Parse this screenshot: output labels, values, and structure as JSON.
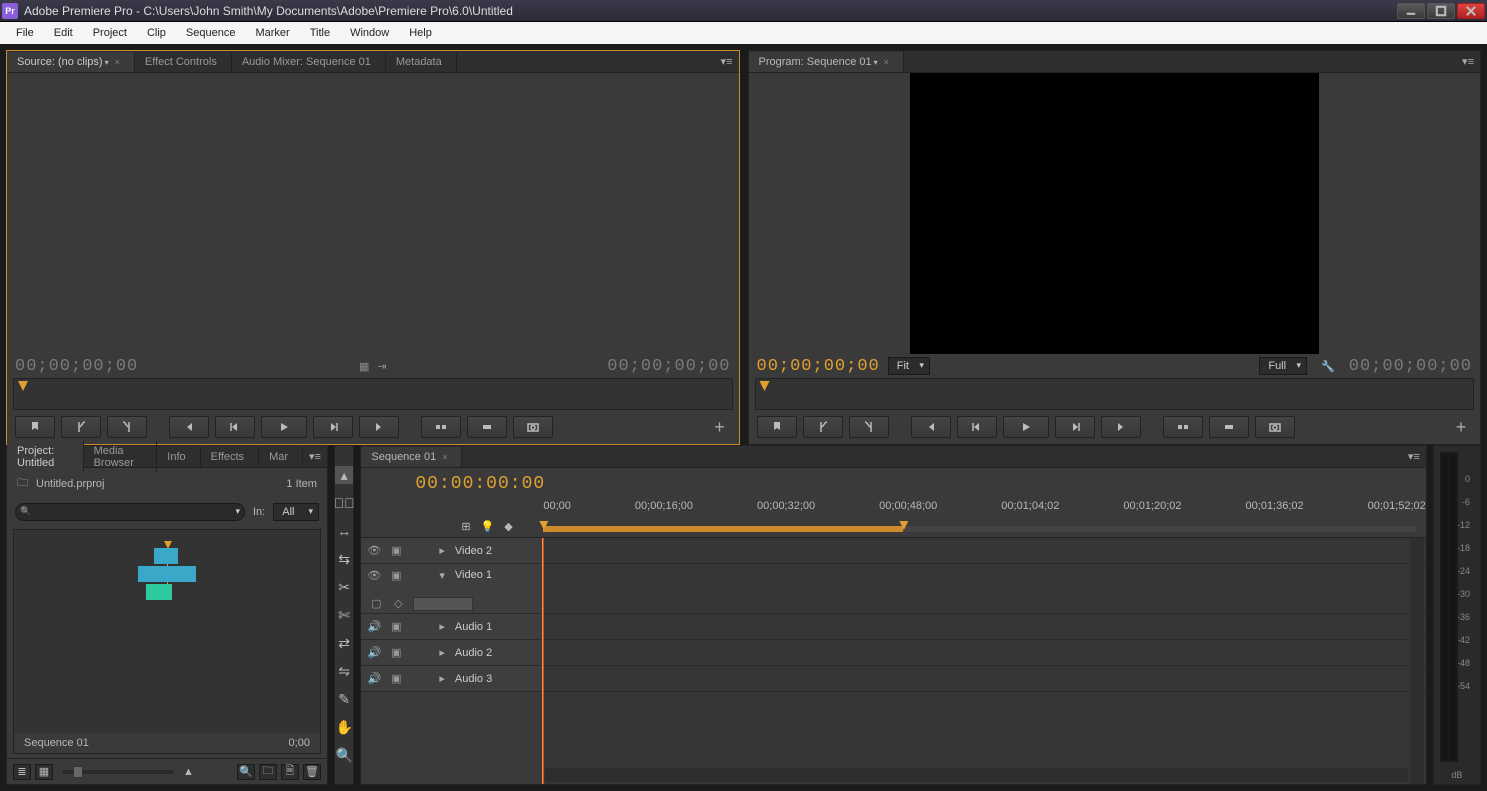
{
  "title": "Adobe Premiere Pro - C:\\Users\\John Smith\\My Documents\\Adobe\\Premiere Pro\\6.0\\Untitled",
  "menu": [
    "File",
    "Edit",
    "Project",
    "Clip",
    "Sequence",
    "Marker",
    "Title",
    "Window",
    "Help"
  ],
  "source": {
    "tabs": [
      "Source: (no clips)",
      "Effect Controls",
      "Audio Mixer: Sequence 01",
      "Metadata"
    ],
    "active_tab": 0,
    "tc_left": "00;00;00;00",
    "tc_right": "00;00;00;00"
  },
  "program": {
    "tab": "Program: Sequence 01",
    "tc_left": "00;00;00;00",
    "tc_right": "00;00;00;00",
    "zoom": "Fit",
    "quality": "Full"
  },
  "project": {
    "tabs": [
      "Project: Untitled",
      "Media Browser",
      "Info",
      "Effects",
      "Mar"
    ],
    "file": "Untitled.prproj",
    "count": "1 Item",
    "in_label": "In:",
    "in_value": "All",
    "seq_name": "Sequence 01",
    "seq_dur": "0;00"
  },
  "timeline": {
    "tab": "Sequence 01",
    "tc": "00:00:00:00",
    "ruler": [
      "00;00",
      "00;00;16;00",
      "00;00;32;00",
      "00;00;48;00",
      "00;01;04;02",
      "00;01;20;02",
      "00;01;36;02",
      "00;01;52;02"
    ],
    "tracks": [
      {
        "name": "Video 2",
        "type": "video",
        "expanded": false
      },
      {
        "name": "Video 1",
        "type": "video",
        "expanded": true
      },
      {
        "name": "Audio 1",
        "type": "audio",
        "expanded": false
      },
      {
        "name": "Audio 2",
        "type": "audio",
        "expanded": false
      },
      {
        "name": "Audio 3",
        "type": "audio",
        "expanded": false
      }
    ]
  },
  "meters": {
    "ticks": [
      "0",
      "-6",
      "-12",
      "-18",
      "-24",
      "-30",
      "-36",
      "-42",
      "-48",
      "-54"
    ],
    "label": "dB"
  }
}
